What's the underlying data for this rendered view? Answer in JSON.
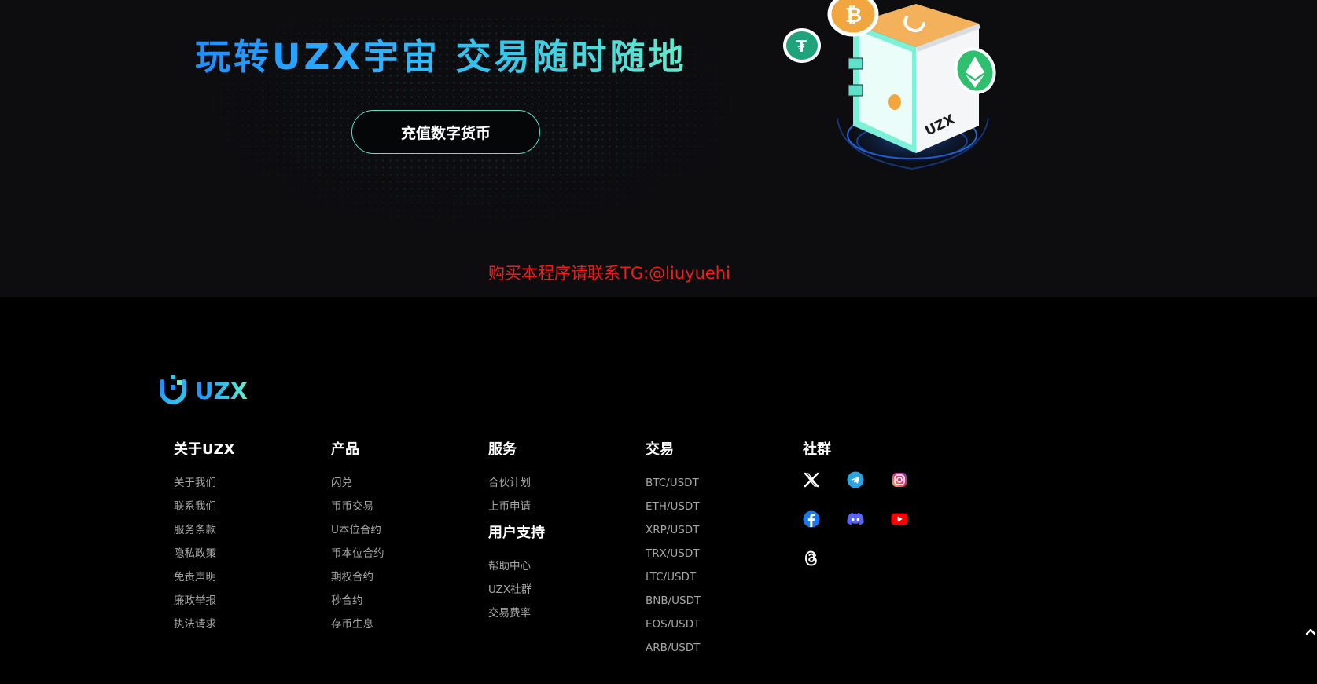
{
  "hero": {
    "title": "玩转UZX宇宙 交易随时随地",
    "deposit_button": "充值数字货币",
    "illustration_label": "UZX",
    "contact": "购买本程序请联系TG:@liuyuehi"
  },
  "footer": {
    "logo_text": "UZX",
    "columns": {
      "about": {
        "heading": "关于UZX",
        "links": [
          "关于我们",
          "联系我们",
          "服务条款",
          "隐私政策",
          "免责声明",
          "廉政举报",
          "执法请求"
        ]
      },
      "products": {
        "heading": "产品",
        "links": [
          "闪兑",
          "币币交易",
          "U本位合约",
          "币本位合约",
          "期权合约",
          "秒合约",
          "存币生息"
        ]
      },
      "services": {
        "heading": "服务",
        "links": [
          "合伙计划",
          "上币申请"
        ],
        "support_heading": "用户支持",
        "support_links": [
          "帮助中心",
          "UZX社群",
          "交易费率"
        ]
      },
      "trade": {
        "heading": "交易",
        "links": [
          "BTC/USDT",
          "ETH/USDT",
          "XRP/USDT",
          "TRX/USDT",
          "LTC/USDT",
          "BNB/USDT",
          "EOS/USDT",
          "ARB/USDT"
        ]
      },
      "community": {
        "heading": "社群",
        "icons": [
          "x-icon",
          "telegram-icon",
          "instagram-icon",
          "facebook-icon",
          "discord-icon",
          "youtube-icon",
          "threads-icon"
        ]
      }
    }
  },
  "colors": {
    "hero_bg": "#0d0d10",
    "footer_bg": "#000000",
    "accent_blue": "#1f8fff",
    "accent_green": "#6df0c6",
    "contact_red": "#f21b1b",
    "link_gray": "#a6a6a6"
  }
}
